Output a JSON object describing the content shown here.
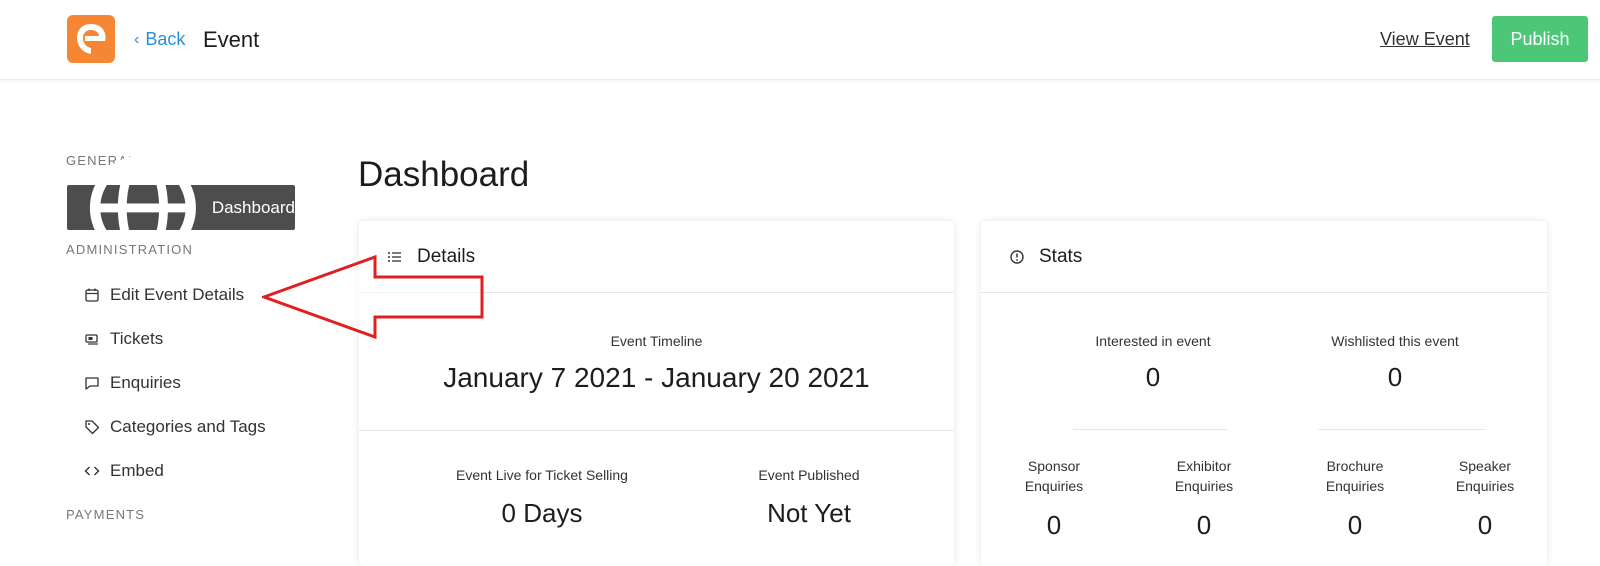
{
  "header": {
    "back_label": "Back",
    "title": "Event",
    "view_event_label": "View Event",
    "publish_label": "Publish",
    "brand_color": "#f58634",
    "publish_color": "#4cc777"
  },
  "sidebar": {
    "general_label": "GENERAL",
    "dashboard_label": "Dashboard",
    "administration_label": "ADMINISTRATION",
    "items": [
      {
        "label": "Edit Event Details",
        "icon": "calendar-icon"
      },
      {
        "label": "Tickets",
        "icon": "ticket-icon"
      },
      {
        "label": "Enquiries",
        "icon": "message-icon"
      },
      {
        "label": "Categories and Tags",
        "icon": "tag-icon"
      },
      {
        "label": "Embed",
        "icon": "code-icon"
      }
    ],
    "payments_label": "PAYMENTS"
  },
  "main": {
    "title": "Dashboard",
    "details": {
      "heading": "Details",
      "timeline_label": "Event Timeline",
      "timeline_value": "January 7 2021 - January 20 2021",
      "live_label": "Event Live for Ticket Selling",
      "live_value": "0 Days",
      "published_label": "Event Published",
      "published_value": "Not Yet"
    },
    "stats": {
      "heading": "Stats",
      "interested_label": "Interested in event",
      "interested_value": "0",
      "wishlisted_label": "Wishlisted this event",
      "wishlisted_value": "0",
      "enquiries": [
        {
          "line1": "Sponsor",
          "line2": "Enquiries",
          "value": "0"
        },
        {
          "line1": "Exhibitor",
          "line2": "Enquiries",
          "value": "0"
        },
        {
          "line1": "Brochure",
          "line2": "Enquiries",
          "value": "0"
        },
        {
          "line1": "Speaker",
          "line2": "Enquiries",
          "value": "0"
        }
      ]
    }
  },
  "annotation": {
    "arrow_color": "#e02020"
  }
}
